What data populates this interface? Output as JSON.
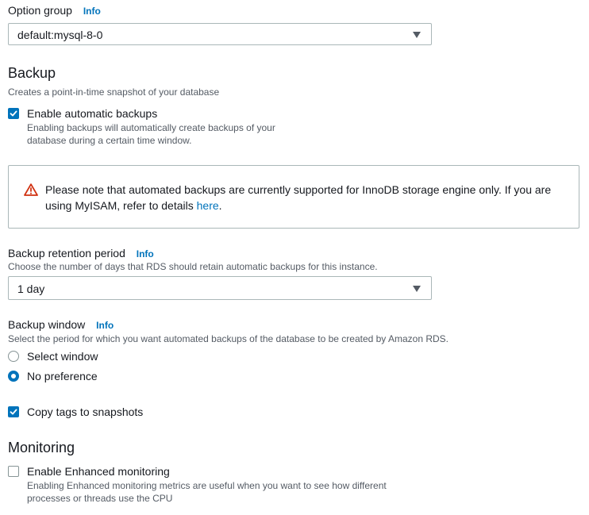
{
  "option_group": {
    "label": "Option group",
    "info": "Info",
    "selected": "default:mysql-8-0"
  },
  "backup": {
    "heading": "Backup",
    "description": "Creates a point-in-time snapshot of your database",
    "enable_label": "Enable automatic backups",
    "enable_checked": true,
    "enable_desc_line1": "Enabling backups will automatically create backups of your",
    "enable_desc_line2": "database during a certain time window."
  },
  "alert": {
    "icon": "warning-icon",
    "text": "Please note that automated backups are currently supported for InnoDB storage engine only. If you are using MyISAM, refer to details ",
    "link": "here",
    "trailing": ".",
    "color": "#d13212"
  },
  "retention": {
    "label": "Backup retention period",
    "info": "Info",
    "description": "Choose the number of days that RDS should retain automatic backups for this instance.",
    "selected": "1 day"
  },
  "window": {
    "label": "Backup window",
    "info": "Info",
    "description": "Select the period for which you want automated backups of the database to be created by Amazon RDS.",
    "options": [
      {
        "label": "Select window",
        "selected": false
      },
      {
        "label": "No preference",
        "selected": true
      }
    ]
  },
  "copy_tags": {
    "label": "Copy tags to snapshots",
    "checked": true
  },
  "monitoring": {
    "heading": "Monitoring",
    "enable_label": "Enable Enhanced monitoring",
    "enable_checked": false,
    "desc_line1": "Enabling Enhanced monitoring metrics are useful when you want to see how different",
    "desc_line2": "processes or threads use the CPU"
  },
  "colors": {
    "accent": "#0073bb",
    "text": "#16191f",
    "muted": "#545b64",
    "border": "#aab7b8"
  }
}
